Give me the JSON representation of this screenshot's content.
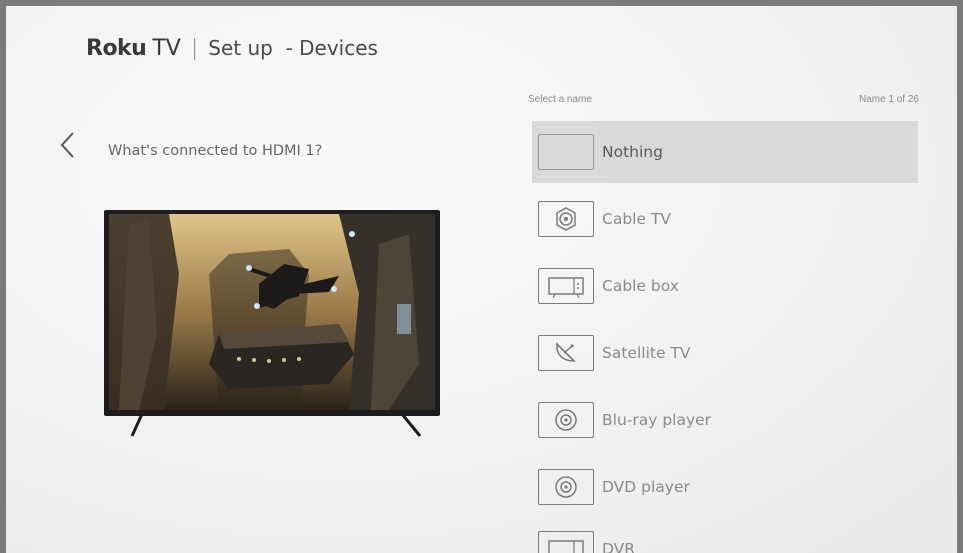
{
  "header": {
    "brand_roku": "Roku",
    "brand_tv": "TV",
    "separator": "|",
    "title": "Set up  - Devices"
  },
  "question": "What's connected to HDMI 1?",
  "list": {
    "select_label": "Select a name",
    "count_label": "Name 1 of 26",
    "items": [
      {
        "label": "Nothing",
        "icon": "blank-icon",
        "selected": true
      },
      {
        "label": "Cable TV",
        "icon": "cable-connector-icon"
      },
      {
        "label": "Cable box",
        "icon": "cable-box-icon"
      },
      {
        "label": "Satellite TV",
        "icon": "satellite-dish-icon"
      },
      {
        "label": "Blu-ray player",
        "icon": "disc-icon"
      },
      {
        "label": "DVD player",
        "icon": "disc-icon"
      },
      {
        "label": "DVR",
        "icon": "dvr-icon"
      }
    ]
  },
  "colors": {
    "selected_bg": "#d9d9d9",
    "text": "#8a8a8a",
    "background": "#f1f1f1"
  }
}
